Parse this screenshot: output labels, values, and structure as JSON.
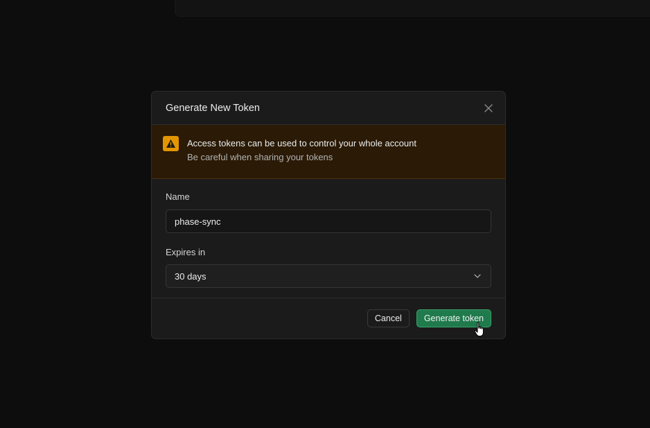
{
  "modal": {
    "title": "Generate New Token",
    "warning": {
      "title": "Access tokens can be used to control your whole account",
      "subtitle": "Be careful when sharing your tokens"
    },
    "name_field": {
      "label": "Name",
      "value": "phase-sync"
    },
    "expires_field": {
      "label": "Expires in",
      "value": "30 days"
    },
    "cancel_label": "Cancel",
    "submit_label": "Generate token"
  },
  "icons": {
    "close": "close-icon",
    "warning": "warning-icon",
    "dropdown": "chevron-down-icon",
    "cursor": "hand-pointer-cursor"
  },
  "colors": {
    "warning_bg": "#2a1a06",
    "warning_icon": "#e39600",
    "primary_button": "#1f7a4c"
  }
}
